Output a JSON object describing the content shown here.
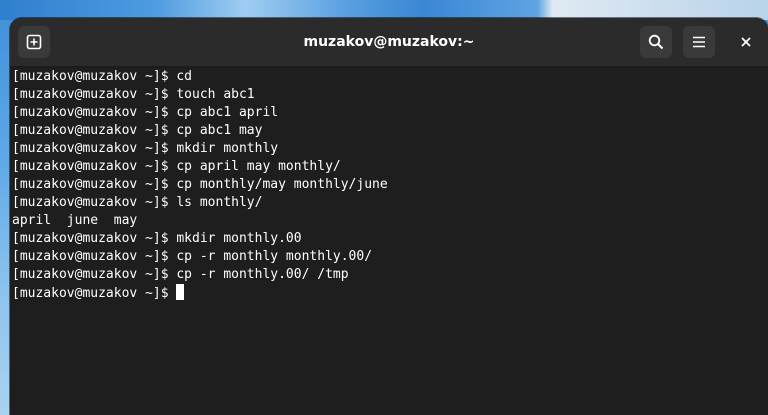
{
  "window": {
    "title": "muzakov@muzakov:~"
  },
  "titlebar": {
    "new_tab_icon": "new-tab-icon",
    "search_icon": "search-icon",
    "menu_icon": "hamburger-menu-icon",
    "close_label": "×"
  },
  "terminal": {
    "lines": [
      "[muzakov@muzakov ~]$ cd",
      "[muzakov@muzakov ~]$ touch abc1",
      "[muzakov@muzakov ~]$ cp abc1 april",
      "[muzakov@muzakov ~]$ cp abc1 may",
      "[muzakov@muzakov ~]$ mkdir monthly",
      "[muzakov@muzakov ~]$ cp april may monthly/",
      "[muzakov@muzakov ~]$ cp monthly/may monthly/june",
      "[muzakov@muzakov ~]$ ls monthly/",
      "april  june  may",
      "[muzakov@muzakov ~]$ mkdir monthly.00",
      "[muzakov@muzakov ~]$ cp -r monthly monthly.00/",
      "[muzakov@muzakov ~]$ cp -r monthly.00/ /tmp"
    ],
    "prompt": "[muzakov@muzakov ~]$ "
  },
  "colors": {
    "background": "#1e1e1e",
    "titlebar": "#2b2b2b",
    "text": "#ffffff"
  }
}
